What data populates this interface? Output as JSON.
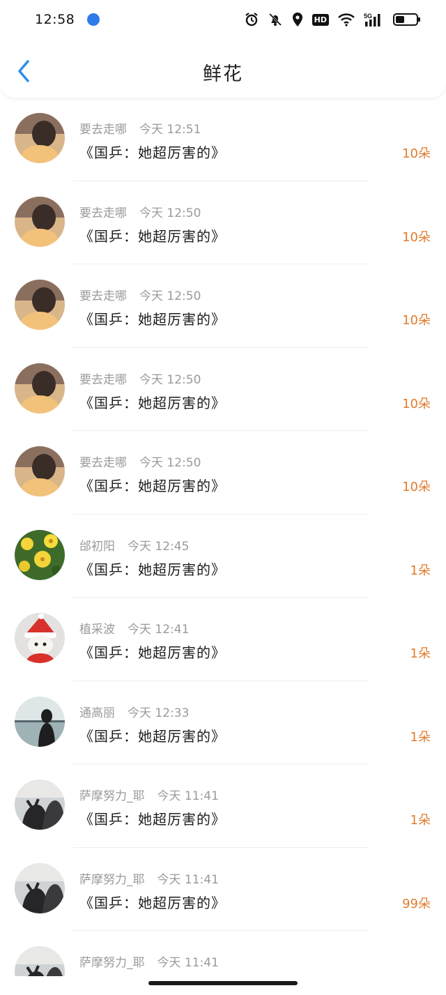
{
  "status_bar": {
    "time": "12:58"
  },
  "header": {
    "title": "鲜花"
  },
  "records": [
    {
      "name": "要去走哪",
      "time": "今天 12:51",
      "message": "《国乒：她超厉害的》",
      "count": "10朵",
      "avatar": "girl-back"
    },
    {
      "name": "要去走哪",
      "time": "今天 12:50",
      "message": "《国乒：她超厉害的》",
      "count": "10朵",
      "avatar": "girl-back"
    },
    {
      "name": "要去走哪",
      "time": "今天 12:50",
      "message": "《国乒：她超厉害的》",
      "count": "10朵",
      "avatar": "girl-back"
    },
    {
      "name": "要去走哪",
      "time": "今天 12:50",
      "message": "《国乒：她超厉害的》",
      "count": "10朵",
      "avatar": "girl-back"
    },
    {
      "name": "要去走哪",
      "time": "今天 12:50",
      "message": "《国乒：她超厉害的》",
      "count": "10朵",
      "avatar": "girl-back"
    },
    {
      "name": "邰初阳",
      "time": "今天 12:45",
      "message": "《国乒：她超厉害的》",
      "count": "1朵",
      "avatar": "yellow-flowers"
    },
    {
      "name": "植采波",
      "time": "今天 12:41",
      "message": "《国乒：她超厉害的》",
      "count": "1朵",
      "avatar": "santa-cat"
    },
    {
      "name": "通高丽",
      "time": "今天 12:33",
      "message": "《国乒：她超厉害的》",
      "count": "1朵",
      "avatar": "seaside-girl"
    },
    {
      "name": "萨摩努力_耶",
      "time": "今天 11:41",
      "message": "《国乒：她超厉害的》",
      "count": "1朵",
      "avatar": "couple-cat"
    },
    {
      "name": "萨摩努力_耶",
      "time": "今天 11:41",
      "message": "《国乒：她超厉害的》",
      "count": "99朵",
      "avatar": "couple-cat"
    },
    {
      "name": "萨摩努力_耶",
      "time": "今天 11:41",
      "message": "",
      "count": "",
      "avatar": "couple-cat"
    }
  ],
  "colors": {
    "accent": "#2b8ee8",
    "count": "#e07b2c",
    "meta": "#9a9a9a"
  }
}
